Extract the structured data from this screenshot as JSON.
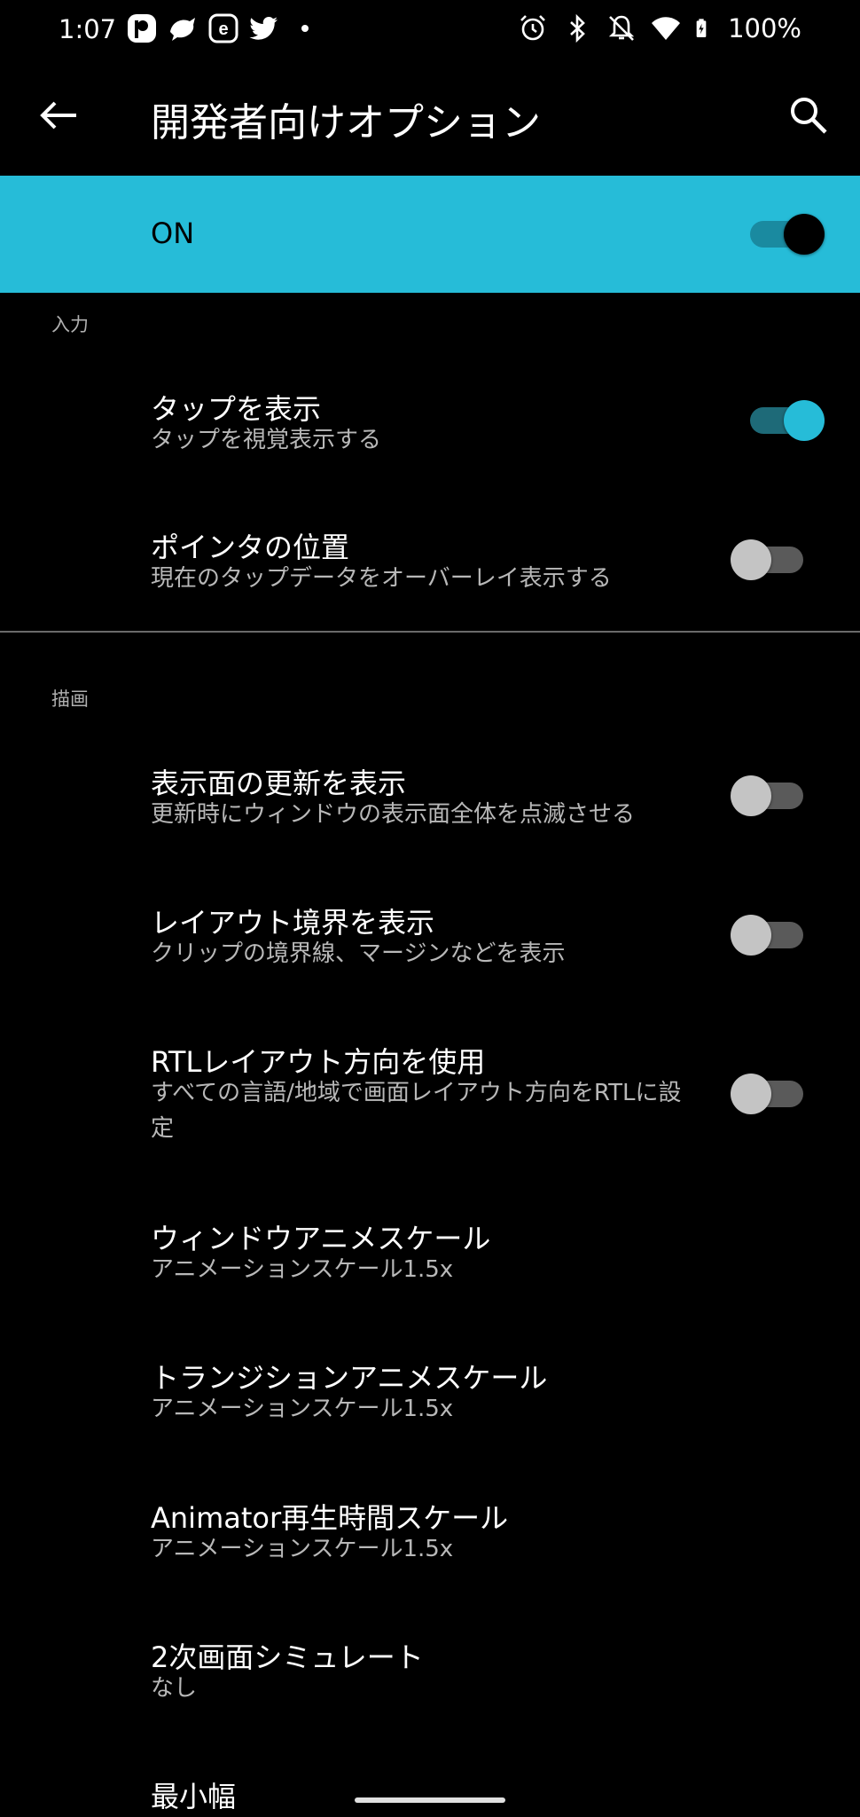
{
  "status_bar": {
    "time": "1:07",
    "battery": "100%",
    "left_icons": [
      "pixiv-icon",
      "notification-bird-icon",
      "e-app-icon",
      "twitter-icon",
      "more-dot-icon"
    ],
    "right_icons": [
      "alarm-icon",
      "bluetooth-icon",
      "mute-bell-icon",
      "wifi-icon",
      "battery-charging-icon"
    ]
  },
  "app_bar": {
    "title": "開発者向けオプション",
    "back_icon": "arrow-back-icon",
    "search_icon": "search-icon"
  },
  "master_switch": {
    "label": "ON",
    "checked": true,
    "color": "#26bcd8"
  },
  "sections": {
    "input": {
      "header": "入力",
      "items": [
        {
          "title": "タップを表示",
          "summary": "タップを視覚表示する",
          "checked": true
        },
        {
          "title": "ポインタの位置",
          "summary": "現在のタップデータをオーバーレイ表示する",
          "checked": false
        }
      ]
    },
    "drawing": {
      "header": "描画",
      "items": [
        {
          "title": "表示面の更新を表示",
          "summary": "更新時にウィンドウの表示面全体を点滅させる",
          "checked": false
        },
        {
          "title": "レイアウト境界を表示",
          "summary": "クリップの境界線、マージンなどを表示",
          "checked": false
        },
        {
          "title": "RTLレイアウト方向を使用",
          "summary": "すべての言語/地域で画面レイアウト方向をRTLに設定",
          "checked": false
        },
        {
          "title": "ウィンドウアニメスケール",
          "summary": "アニメーションスケール1.5x"
        },
        {
          "title": "トランジションアニメスケール",
          "summary": "アニメーションスケール1.5x"
        },
        {
          "title": "Animator再生時間スケール",
          "summary": "アニメーションスケール1.5x"
        },
        {
          "title": "2次画面シミュレート",
          "summary": "なし"
        },
        {
          "title": "最小幅",
          "summary": ""
        }
      ]
    }
  },
  "colors": {
    "accent": "#26bcd8",
    "background": "#000000",
    "secondary_text": "#b8b8b8"
  }
}
